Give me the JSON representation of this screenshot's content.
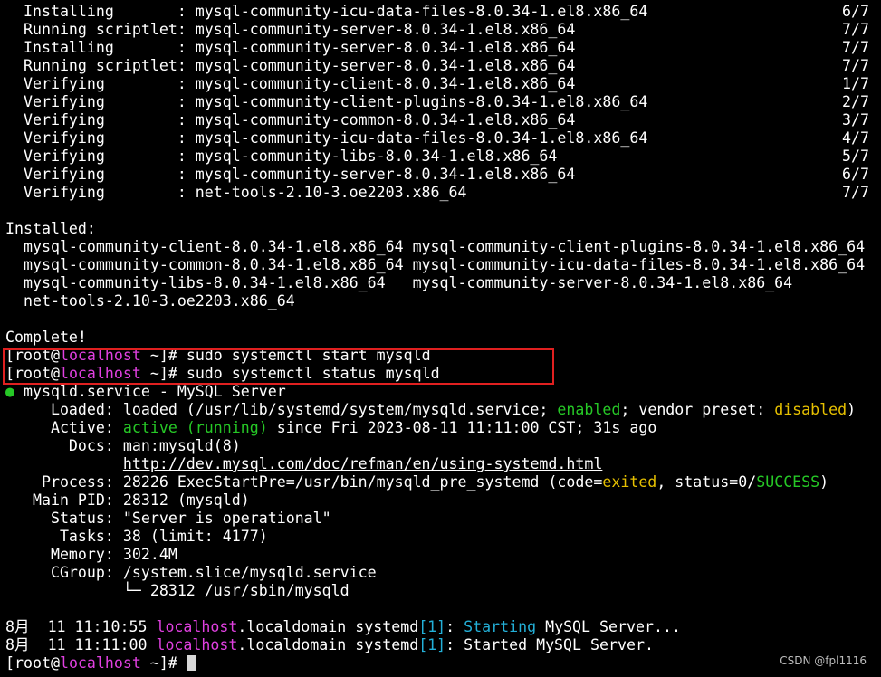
{
  "colors": {
    "background": "#000000",
    "text": "#ffffff",
    "hostname": "#e040e0",
    "active_green": "#26c826",
    "warning_yellow": "#e6c000",
    "cyan": "#23b0d8",
    "highlight_border": "#e02020"
  },
  "transaction": [
    {
      "action": "  Installing       : ",
      "package": "mysql-community-icu-data-files-8.0.34-1.el8.x86_64",
      "progress": "6/7"
    },
    {
      "action": "  Running scriptlet: ",
      "package": "mysql-community-server-8.0.34-1.el8.x86_64",
      "progress": "7/7"
    },
    {
      "action": "  Installing       : ",
      "package": "mysql-community-server-8.0.34-1.el8.x86_64",
      "progress": "7/7"
    },
    {
      "action": "  Running scriptlet: ",
      "package": "mysql-community-server-8.0.34-1.el8.x86_64",
      "progress": "7/7"
    },
    {
      "action": "  Verifying        : ",
      "package": "mysql-community-client-8.0.34-1.el8.x86_64",
      "progress": "1/7"
    },
    {
      "action": "  Verifying        : ",
      "package": "mysql-community-client-plugins-8.0.34-1.el8.x86_64",
      "progress": "2/7"
    },
    {
      "action": "  Verifying        : ",
      "package": "mysql-community-common-8.0.34-1.el8.x86_64",
      "progress": "3/7"
    },
    {
      "action": "  Verifying        : ",
      "package": "mysql-community-icu-data-files-8.0.34-1.el8.x86_64",
      "progress": "4/7"
    },
    {
      "action": "  Verifying        : ",
      "package": "mysql-community-libs-8.0.34-1.el8.x86_64",
      "progress": "5/7"
    },
    {
      "action": "  Verifying        : ",
      "package": "mysql-community-server-8.0.34-1.el8.x86_64",
      "progress": "6/7"
    },
    {
      "action": "  Verifying        : ",
      "package": "net-tools-2.10-3.oe2203.x86_64",
      "progress": "7/7"
    }
  ],
  "installed": {
    "header": "Installed:",
    "lines": [
      "  mysql-community-client-8.0.34-1.el8.x86_64 mysql-community-client-plugins-8.0.34-1.el8.x86_64",
      "  mysql-community-common-8.0.34-1.el8.x86_64 mysql-community-icu-data-files-8.0.34-1.el8.x86_64",
      "  mysql-community-libs-8.0.34-1.el8.x86_64   mysql-community-server-8.0.34-1.el8.x86_64",
      "  net-tools-2.10-3.oe2203.x86_64"
    ]
  },
  "complete": "Complete!",
  "prompt": {
    "open": "[root@",
    "host": "localhost",
    "close": " ~]# "
  },
  "commands": {
    "start": "sudo systemctl start mysqld",
    "status": "sudo systemctl status mysqld"
  },
  "status": {
    "bullet": "●",
    "service": " mysqld.service - MySQL Server",
    "loaded_prefix": "     Loaded: loaded (/usr/lib/systemd/system/mysqld.service; ",
    "loaded_enabled": "enabled",
    "loaded_mid": "; vendor preset: ",
    "loaded_disabled": "disabled",
    "loaded_suffix": ")",
    "active_prefix": "     Active: ",
    "active_state": "active (running)",
    "active_suffix": " since Fri 2023-08-11 11:11:00 CST; 31s ago",
    "docs": "       Docs: man:mysqld(8)",
    "docs_indent": "             ",
    "docs_link": "http://dev.mysql.com/doc/refman/en/using-systemd.html",
    "process_prefix": "    Process: 28226 ExecStartPre=/usr/bin/mysqld_pre_systemd (code=",
    "process_code": "exited",
    "process_mid": ", status=0/",
    "process_status": "SUCCESS",
    "process_suffix": ")",
    "main_pid": "   Main PID: 28312 (mysqld)",
    "status_line": "     Status: \"Server is operational\"",
    "tasks": "      Tasks: 38 (limit: 4177)",
    "memory": "     Memory: 302.4M",
    "cgroup": "     CGroup: /system.slice/mysqld.service",
    "cgroup_child": "             └─ 28312 /usr/sbin/mysqld"
  },
  "journal": [
    {
      "time": "8月  11 11:10:55 ",
      "host": "localhost",
      "rest": ".localdomain systemd",
      "pid": "[1]",
      "sep": ": ",
      "msg_colored": "Starting",
      "msg": " MySQL Server..."
    },
    {
      "time": "8月  11 11:11:00 ",
      "host": "localhost",
      "rest": ".localdomain systemd",
      "pid": "[1]",
      "sep": ": ",
      "msg_colored": "",
      "msg": "Started MySQL Server."
    }
  ],
  "watermark": "CSDN @fpl1116"
}
